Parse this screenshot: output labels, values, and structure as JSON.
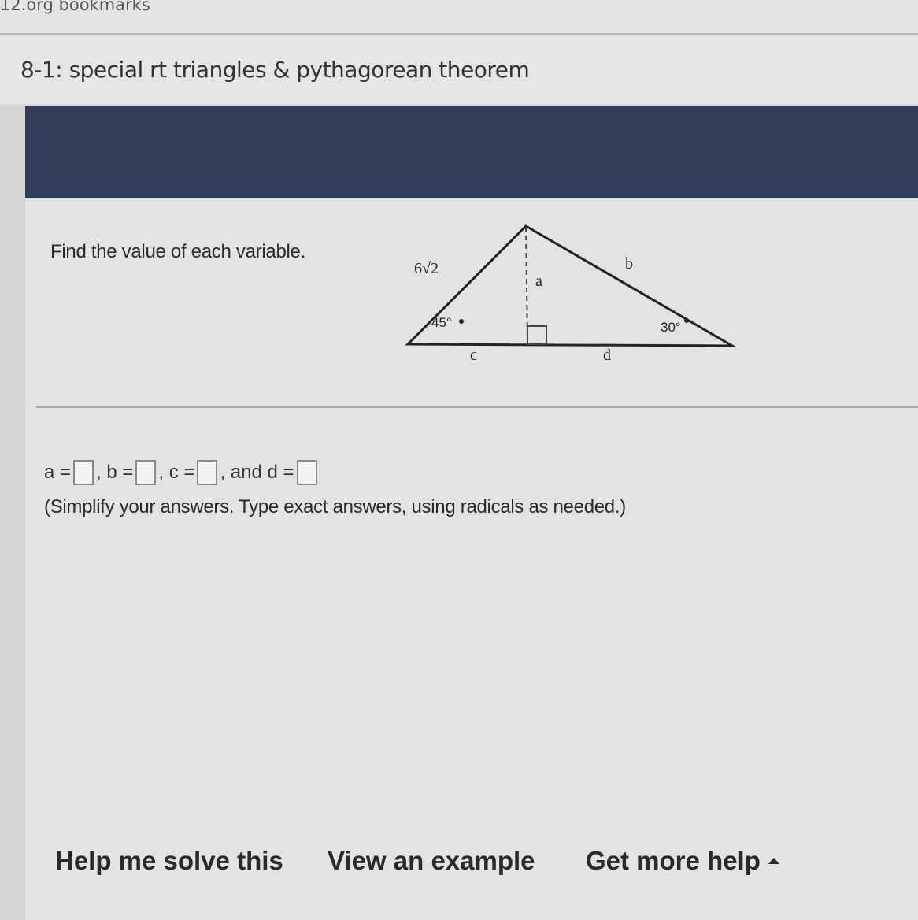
{
  "browser": {
    "bookmarks_label": "12.org bookmarks"
  },
  "assignment": {
    "title": "8-1: special rt triangles & pythagorean theorem"
  },
  "question": {
    "instruction": "Find the value of each variable.",
    "figure": {
      "hypotenuse_left": "6√2",
      "angle_left": "45°",
      "altitude": "a",
      "side_right": "b",
      "angle_right": "30°",
      "base_left": "c",
      "base_right": "d"
    },
    "answer": {
      "a_label": "a =",
      "b_label": ", b =",
      "c_label": ", c =",
      "d_label": ", and d =",
      "a_value": "",
      "b_value": "",
      "c_value": "",
      "d_value": ""
    },
    "hint": "(Simplify your answers. Type exact answers, using radicals as needed.)"
  },
  "footer": {
    "help_solve": "Help me solve this",
    "view_example": "View an example",
    "more_help": "Get more help",
    "more_help_icon": "caret-up-icon"
  }
}
